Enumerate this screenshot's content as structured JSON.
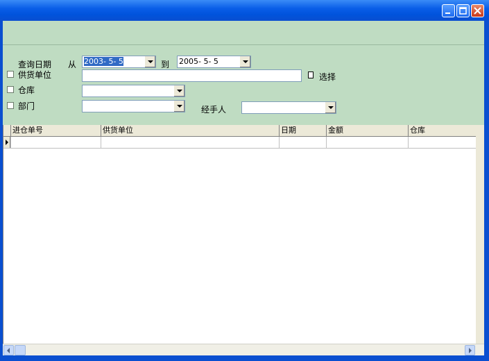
{
  "window": {
    "title": "",
    "controls": {
      "minimize": "minimize-icon",
      "maximize": "maximize-icon",
      "close": "close-icon"
    }
  },
  "filters": {
    "query_date_label": "查询日期",
    "from_label": "从",
    "from_date": "2003- 5- 5",
    "to_label": "到",
    "to_date": "2005- 5- 5",
    "supplier_label": "供货单位",
    "supplier_value": "",
    "select_button": "选择",
    "warehouse_label": "仓库",
    "warehouse_value": "",
    "department_label": "部门",
    "department_value": "",
    "handler_label": "经手人",
    "handler_value": ""
  },
  "grid": {
    "columns": [
      "进仓单号",
      "供货单位",
      "日期",
      "金额",
      "仓库"
    ],
    "rows": [
      [
        "",
        "",
        "",
        "",
        ""
      ]
    ]
  },
  "colors": {
    "panel": "#bfdcc2",
    "titlebar": "#0a5ee8",
    "selection": "#316ac5"
  }
}
